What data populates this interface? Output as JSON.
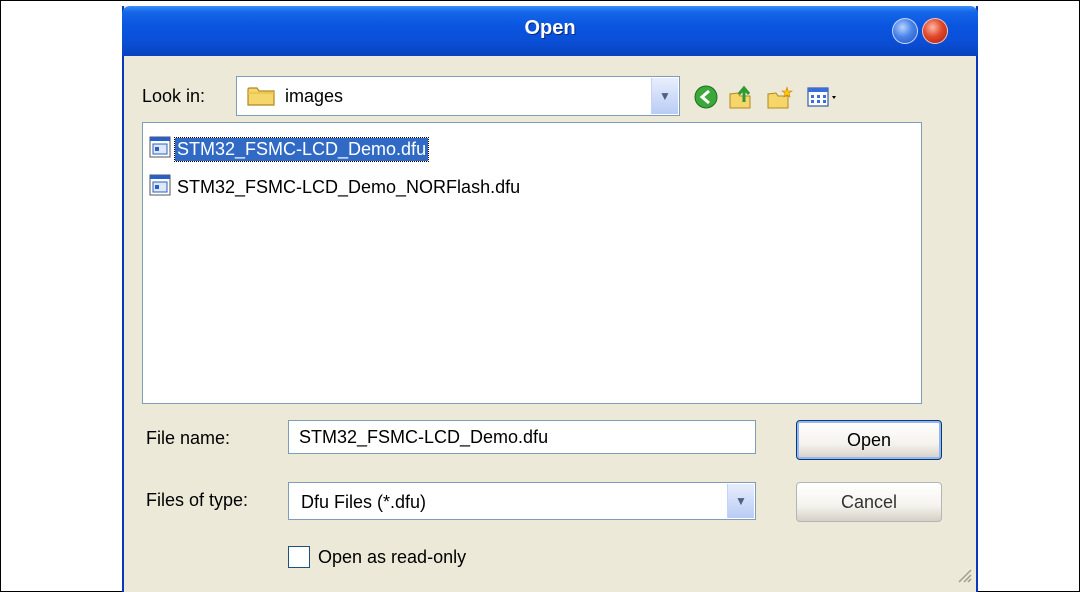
{
  "window": {
    "title": "Open"
  },
  "look_in": {
    "label": "Look in:",
    "value": "images",
    "folder_icon": "folder-icon"
  },
  "toolbar": {
    "icons": [
      "back-icon",
      "up-folder-icon",
      "new-folder-icon",
      "view-menu-icon"
    ]
  },
  "files": [
    {
      "name": "STM32_FSMC-LCD_Demo.dfu",
      "selected": true,
      "icon": "dfu-file-icon"
    },
    {
      "name": "STM32_FSMC-LCD_Demo_NORFlash.dfu",
      "selected": false,
      "icon": "dfu-file-icon"
    }
  ],
  "file_name": {
    "label": "File name:",
    "value": "STM32_FSMC-LCD_Demo.dfu"
  },
  "file_type": {
    "label": "Files of type:",
    "value": "Dfu Files (*.dfu)"
  },
  "buttons": {
    "open": "Open",
    "cancel": "Cancel"
  },
  "readonly": {
    "label": "Open as read-only",
    "checked": false
  },
  "colors": {
    "titlebar": "#0a55e0",
    "selection": "#316ac5",
    "dialog_bg": "#ece9d8"
  }
}
